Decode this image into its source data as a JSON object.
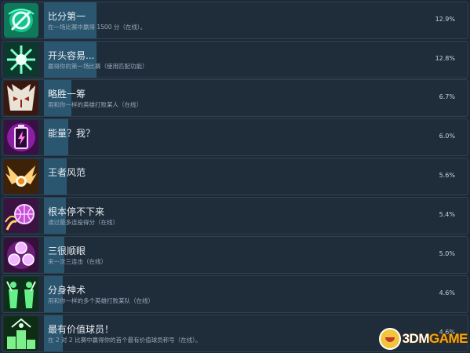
{
  "achievements": [
    {
      "title": "比分第一",
      "desc": "在一场比赛中赢得 1500 分（在线）。",
      "percent": "12.9%",
      "icon": "vortex-badge-icon",
      "progress": 0.129
    },
    {
      "title": "开头容易...",
      "desc": "赢得你的第一场比赛（使用匹配功能）",
      "percent": "12.8%",
      "icon": "burst-badge-icon",
      "progress": 0.128
    },
    {
      "title": "略胜一筹",
      "desc": "用和你一样的英雄打败某人（在线）",
      "percent": "6.7%",
      "icon": "mask-badge-icon",
      "progress": 0.067
    },
    {
      "title": "能量？我？",
      "desc": "",
      "percent": "6.0%",
      "icon": "battery-badge-icon",
      "progress": 0.06
    },
    {
      "title": "王者风范",
      "desc": "",
      "percent": "5.6%",
      "icon": "wings-badge-icon",
      "progress": 0.056
    },
    {
      "title": "根本停不下来",
      "desc": "通过最多连投得分（在线）",
      "percent": "5.4%",
      "icon": "basketball-badge-icon",
      "progress": 0.054
    },
    {
      "title": "三很顺眼",
      "desc": "来一次三连击（在线）",
      "percent": "5.0%",
      "icon": "triple-orb-badge-icon",
      "progress": 0.05
    },
    {
      "title": "分身神术",
      "desc": "用和你一样的多个英雄打败某队（在线）",
      "percent": "4.6%",
      "icon": "clones-badge-icon",
      "progress": 0.046
    },
    {
      "title": "最有价值球员！",
      "desc": "在 2 对 2 比赛中赢得你的首个最有价值球员称号（在线）。",
      "percent": "4.6%",
      "icon": "podium-badge-icon",
      "progress": 0.046
    }
  ],
  "watermark": {
    "prefix": "3DM",
    "suffix": "GAME"
  }
}
